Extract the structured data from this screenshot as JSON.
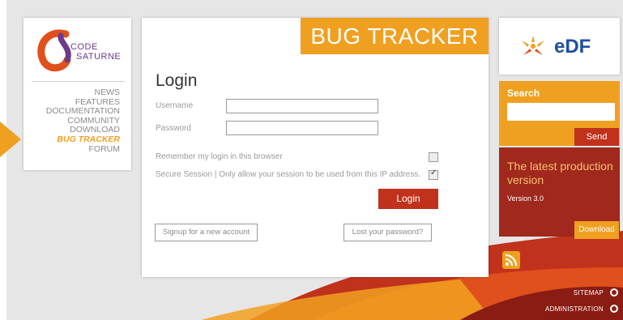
{
  "nav": {
    "items": [
      {
        "label": "NEWS",
        "active": false
      },
      {
        "label": "FEATURES",
        "active": false
      },
      {
        "label": "DOCUMENTATION",
        "active": false
      },
      {
        "label": "COMMUNITY",
        "active": false
      },
      {
        "label": "DOWNLOAD",
        "active": false
      },
      {
        "label": "BUG TRACKER",
        "active": true
      },
      {
        "label": "FORUM",
        "active": false
      }
    ],
    "logo_line1": "CODE",
    "logo_line2": "SATURNE"
  },
  "login": {
    "banner": "BUG TRACKER",
    "title": "Login",
    "username_label": "Username",
    "password_label": "Password",
    "username_value": "",
    "password_value": "",
    "remember_label": "Remember my login in this browser",
    "remember_checked": false,
    "secure_label": "Secure Session | Only allow your session to be used from this IP address.",
    "secure_checked": true,
    "login_button": "Login",
    "signup_button": "Signup for a new account",
    "lost_password_button": "Lost your password?"
  },
  "sidebar": {
    "brand": "eDF",
    "search_label": "Search",
    "search_value": "",
    "send_button": "Send",
    "latest_title": "The latest production version",
    "version": "Version 3.0",
    "download_button": "Download",
    "sitemap": "SITEMAP",
    "administration": "ADMINISTRATION"
  },
  "colors": {
    "accent": "#f0a020",
    "primary_red": "#c0321c",
    "dark_red": "#a0281c",
    "logo_purple": "#6b3a8a",
    "brand_blue": "#1f4fa0"
  },
  "icons": [
    "arrow-icon",
    "code-saturne-logo-icon",
    "edf-logo-icon",
    "rss-icon",
    "sitemap-icon",
    "administration-icon"
  ]
}
